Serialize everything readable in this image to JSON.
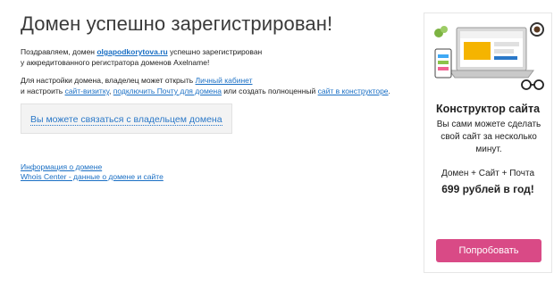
{
  "page": {
    "title": "Домен успешно зарегистрирован!",
    "congrats_prefix": "Поздравляем, домен ",
    "domain": "olgapodkorytova.ru",
    "congrats_suffix": " успешно зарегистрирован",
    "congrats_line2": "у аккредитованного регистратора доменов Axelname!",
    "setup_prefix": "Для настройки домена, владелец может открыть ",
    "personal_cabinet_link": "Личный кабинет",
    "setup_and": "и настроить ",
    "business_card_link": "сайт-визитку",
    "comma": ", ",
    "connect_mail_link": "подключить Почту для домена",
    "setup_or": " или создать полноценный ",
    "site_builder_link": "сайт в конструкторе",
    "period": ".",
    "contact_owner_link": "Вы можете связаться с владельцем домена",
    "domain_info_link": "Информация о домене",
    "whois_link": "Whois Center - данные о домене и сайте"
  },
  "ad": {
    "title": "Конструктор сайта",
    "description": "Вы сами можете сделать свой сайт за несколько минут.",
    "offer": "Домен + Сайт + Почта",
    "price": "699 рублей в год!",
    "button_label": "Попробовать",
    "button_color": "#d94a86"
  }
}
